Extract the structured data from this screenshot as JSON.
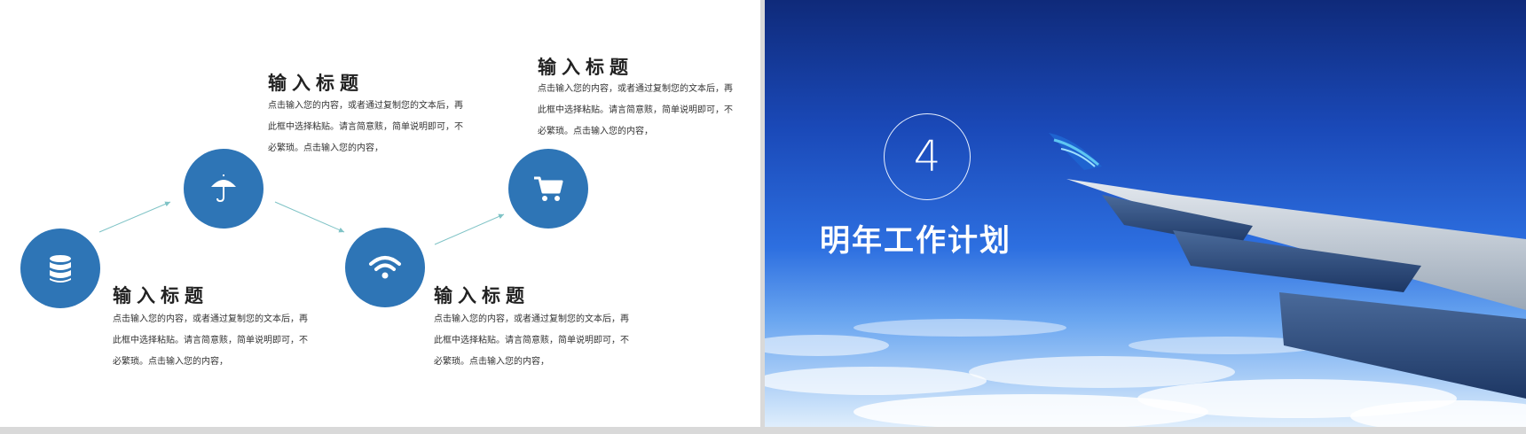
{
  "left_panel": {
    "items": [
      {
        "icon": "database-icon",
        "title": "输入标题",
        "desc": "点击输入您的内容，或者通过复制您的文本后，再此框中选择粘贴。请言简意赅，简单说明即可，不必繁琐。点击输入您的内容，"
      },
      {
        "icon": "umbrella-icon",
        "title": "输入标题",
        "desc": "点击输入您的内容，或者通过复制您的文本后，再此框中选择粘贴。请言简意赅，简单说明即可，不必繁琐。点击输入您的内容，"
      },
      {
        "icon": "wifi-icon",
        "title": "输入标题",
        "desc": "点击输入您的内容，或者通过复制您的文本后，再此框中选择粘贴。请言简意赅，简单说明即可，不必繁琐。点击输入您的内容，"
      },
      {
        "icon": "shopping-cart-icon",
        "title": "输入标题",
        "desc": "点击输入您的内容，或者通过复制您的文本后，再此框中选择粘贴。请言简意赅，简单说明即可，不必繁琐。点击输入您的内容，"
      }
    ],
    "accent_color": "#2e75b6",
    "arrow_color": "#7fc3c6"
  },
  "right_panel": {
    "section_number": "4",
    "section_title": "明年工作计划"
  }
}
